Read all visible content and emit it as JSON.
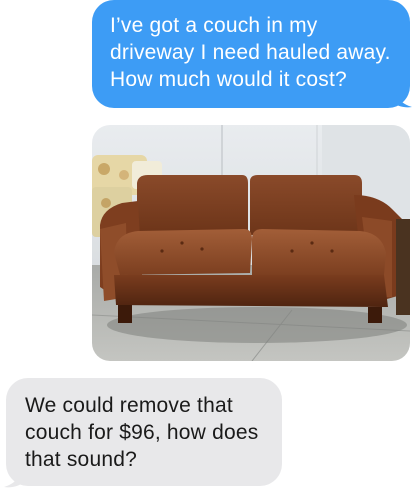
{
  "thread": {
    "outgoing_message": {
      "lines": [
        "I’ve got a couch in my",
        "driveway I need hauled away.",
        "How much would it cost?"
      ],
      "color": "#3d9cf5"
    },
    "photo_message": {
      "subject": "brown couch photo",
      "icon": "couch-photo"
    },
    "incoming_message": {
      "lines": [
        "We could remove that",
        "couch for $96, how does",
        "that sound?"
      ],
      "color": "#e8e8ea"
    }
  }
}
